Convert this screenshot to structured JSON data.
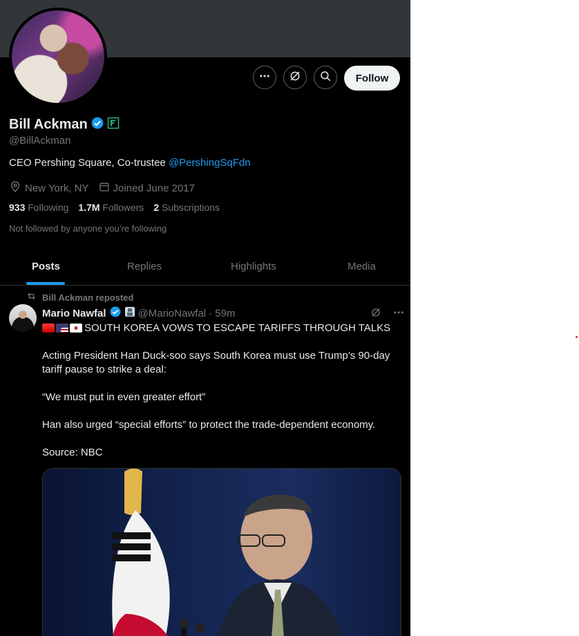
{
  "profile": {
    "name": "Bill Ackman",
    "handle": "@BillAckman",
    "bio_text": "CEO Pershing Square, Co-trustee ",
    "bio_link": "@PershingSqFdn",
    "location": "New York, NY",
    "joined": "Joined June 2017",
    "following_count": "933",
    "following_label": "Following",
    "followers_count": "1.7M",
    "followers_label": "Followers",
    "subscriptions_count": "2",
    "subscriptions_label": "Subscriptions",
    "not_followed": "Not followed by anyone you’re following"
  },
  "actions": {
    "follow_label": "Follow"
  },
  "tabs": [
    {
      "label": "Posts"
    },
    {
      "label": "Replies"
    },
    {
      "label": "Highlights"
    },
    {
      "label": "Media"
    }
  ],
  "post": {
    "repost_label": "Bill Ackman reposted",
    "author_name": "Mario Nawfal",
    "author_handle": "@MarioNawfal",
    "time": "· 59m",
    "headline": "SOUTH KOREA VOWS TO ESCAPE TARIFFS THROUGH TALKS",
    "paragraph1": "Acting President Han Duck-soo says South Korea must use Trump’s 90-day tariff pause to strike a deal:",
    "paragraph2": "“We must put in even greater effort”",
    "paragraph3": "Han also urged “special efforts” to protect the trade-dependent economy.",
    "paragraph4": "Source: NBC"
  },
  "colors": {
    "accent": "#1d9bf0",
    "background": "#000000",
    "text_primary": "#e7e9ea",
    "text_secondary": "#71767b",
    "verified": "#1d9bf0"
  },
  "icons": {
    "more": "more-horizontal-icon",
    "grok": "grok-icon",
    "search": "search-icon",
    "verified": "verified-badge-icon",
    "affiliate": "affiliate-badge-icon",
    "location": "location-pin-icon",
    "calendar": "calendar-icon",
    "repost": "repost-icon"
  }
}
